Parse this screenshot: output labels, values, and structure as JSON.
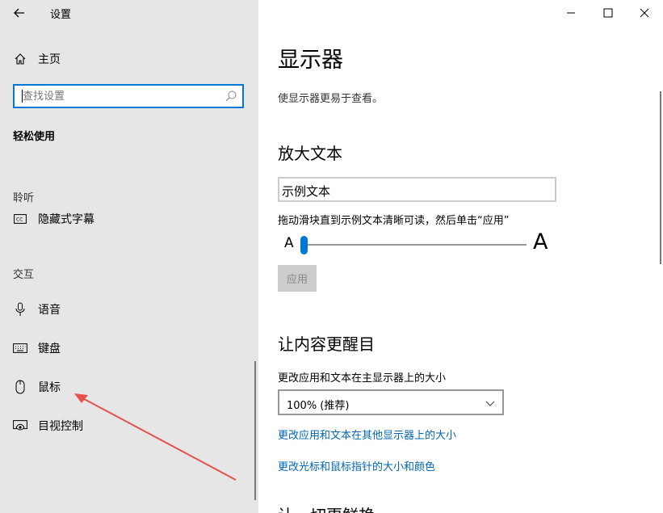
{
  "app": {
    "title": "设置"
  },
  "window": {
    "minimize": "—",
    "maximize": "☐",
    "close": "✕"
  },
  "sidebar": {
    "home_label": "主页",
    "search_placeholder": "查找设置",
    "section_title": "轻松使用",
    "groups": {
      "hearing": {
        "label": "聆听",
        "items": [
          {
            "label": "隐藏式字幕",
            "icon": "closed-captions-icon"
          }
        ]
      },
      "interaction": {
        "label": "交互",
        "items": [
          {
            "label": "语音",
            "icon": "microphone-icon"
          },
          {
            "label": "键盘",
            "icon": "keyboard-icon"
          },
          {
            "label": "鼠标",
            "icon": "mouse-icon"
          },
          {
            "label": "目视控制",
            "icon": "eye-control-icon"
          }
        ]
      }
    }
  },
  "main": {
    "title": "显示器",
    "description": "使显示器更易于查看。",
    "enlarge_text": {
      "heading": "放大文本",
      "sample_text": "示例文本",
      "hint": "拖动滑块直到示例文本清晰可读，然后单击“应用”",
      "slider_small_label": "A",
      "slider_large_label": "A",
      "slider_value": 0,
      "apply_label": "应用"
    },
    "make_bigger": {
      "heading": "让内容更醒目",
      "size_label": "更改应用和文本在主显示器上的大小",
      "size_value": "100% (推荐)",
      "link_other_displays": "更改应用和文本在其他显示器上的大小",
      "link_cursor": "更改光标和鼠标指针的大小和颜色"
    },
    "next_heading": "让一切更鲜艳"
  },
  "colors": {
    "accent": "#0078d7",
    "link": "#0066b4",
    "annotation_arrow": "#e8504a"
  }
}
